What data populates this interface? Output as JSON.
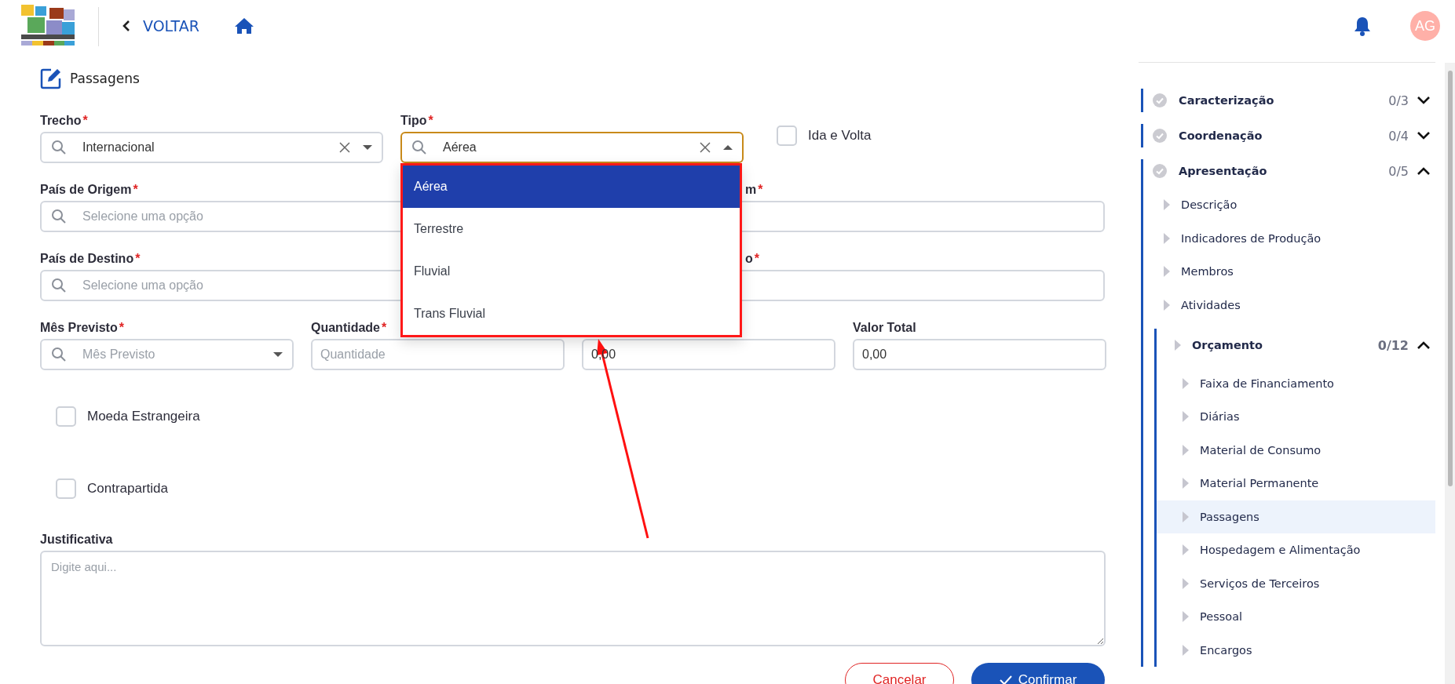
{
  "header": {
    "back_label": "VOLTAR",
    "avatar_initials": "AG"
  },
  "page_title": "Passagens",
  "form": {
    "rows": [
      [
        {
          "kind": "select",
          "label": "Trecho",
          "required_mark": "*",
          "value": "Internacional",
          "open": false
        },
        {
          "kind": "select",
          "label": "Tipo",
          "required_mark": "*",
          "value": "Aérea",
          "open": true,
          "options": [
            {
              "label": "Aérea",
              "selected": true
            },
            {
              "label": "Terrestre",
              "selected": false
            },
            {
              "label": "Fluvial",
              "selected": false
            },
            {
              "label": "Trans Fluvial",
              "selected": false
            }
          ]
        },
        {
          "kind": "checkbox",
          "label": "Ida e Volta",
          "checked": false
        }
      ],
      [
        {
          "kind": "search",
          "label": "País de Origem",
          "required_mark": "*",
          "placeholder": "Selecione uma opção"
        },
        {
          "kind": "text",
          "label": "m",
          "required_mark": "*"
        }
      ],
      [
        {
          "kind": "search",
          "label": "País de Destino",
          "required_mark": "*",
          "placeholder": "Selecione uma opção"
        },
        {
          "kind": "text",
          "label": "o",
          "required_mark": "*"
        }
      ],
      [
        {
          "kind": "select",
          "label": "Mês Previsto",
          "required_mark": "*",
          "placeholder": "Mês Previsto",
          "open": false
        },
        {
          "kind": "text",
          "label": "Quantidade",
          "required_mark": "*",
          "placeholder": "Quantidade"
        },
        {
          "kind": "text",
          "value": "0,00"
        },
        {
          "kind": "text",
          "label": "Valor Total",
          "value": "0,00"
        }
      ]
    ],
    "checkboxes": [
      {
        "label": "Moeda Estrangeira",
        "checked": false
      },
      {
        "label": "Contrapartida",
        "checked": false
      }
    ],
    "justification": {
      "label": "Justificativa",
      "placeholder": "Digite aqui..."
    },
    "buttons": [
      {
        "label": "Cancelar",
        "kind": "secondary"
      },
      {
        "label": "Confirmar",
        "kind": "primary"
      }
    ]
  },
  "sidebar": {
    "sections": [
      {
        "label": "Caracterização",
        "count": "0/3",
        "expanded": false
      },
      {
        "label": "Coordenação",
        "count": "0/4",
        "expanded": false
      },
      {
        "label": "Apresentação",
        "count": "0/5",
        "expanded": true,
        "children": [
          {
            "label": "Descrição",
            "selected": false
          },
          {
            "label": "Indicadores de Produção",
            "selected": false
          },
          {
            "label": "Membros",
            "selected": false
          },
          {
            "label": "Atividades",
            "selected": false
          },
          {
            "label": "Orçamento",
            "count": "0/12",
            "expanded": true,
            "selected": false,
            "children": [
              {
                "label": "Faixa de Financiamento",
                "selected": false
              },
              {
                "label": "Diárias",
                "selected": false
              },
              {
                "label": "Material de Consumo",
                "selected": false
              },
              {
                "label": "Material Permanente",
                "selected": false
              },
              {
                "label": "Passagens",
                "selected": true
              },
              {
                "label": "Hospedagem e Alimentação",
                "selected": false
              },
              {
                "label": "Serviços de Terceiros",
                "selected": false
              },
              {
                "label": "Pessoal",
                "selected": false
              },
              {
                "label": "Encargos",
                "selected": false
              }
            ]
          }
        ]
      }
    ]
  }
}
